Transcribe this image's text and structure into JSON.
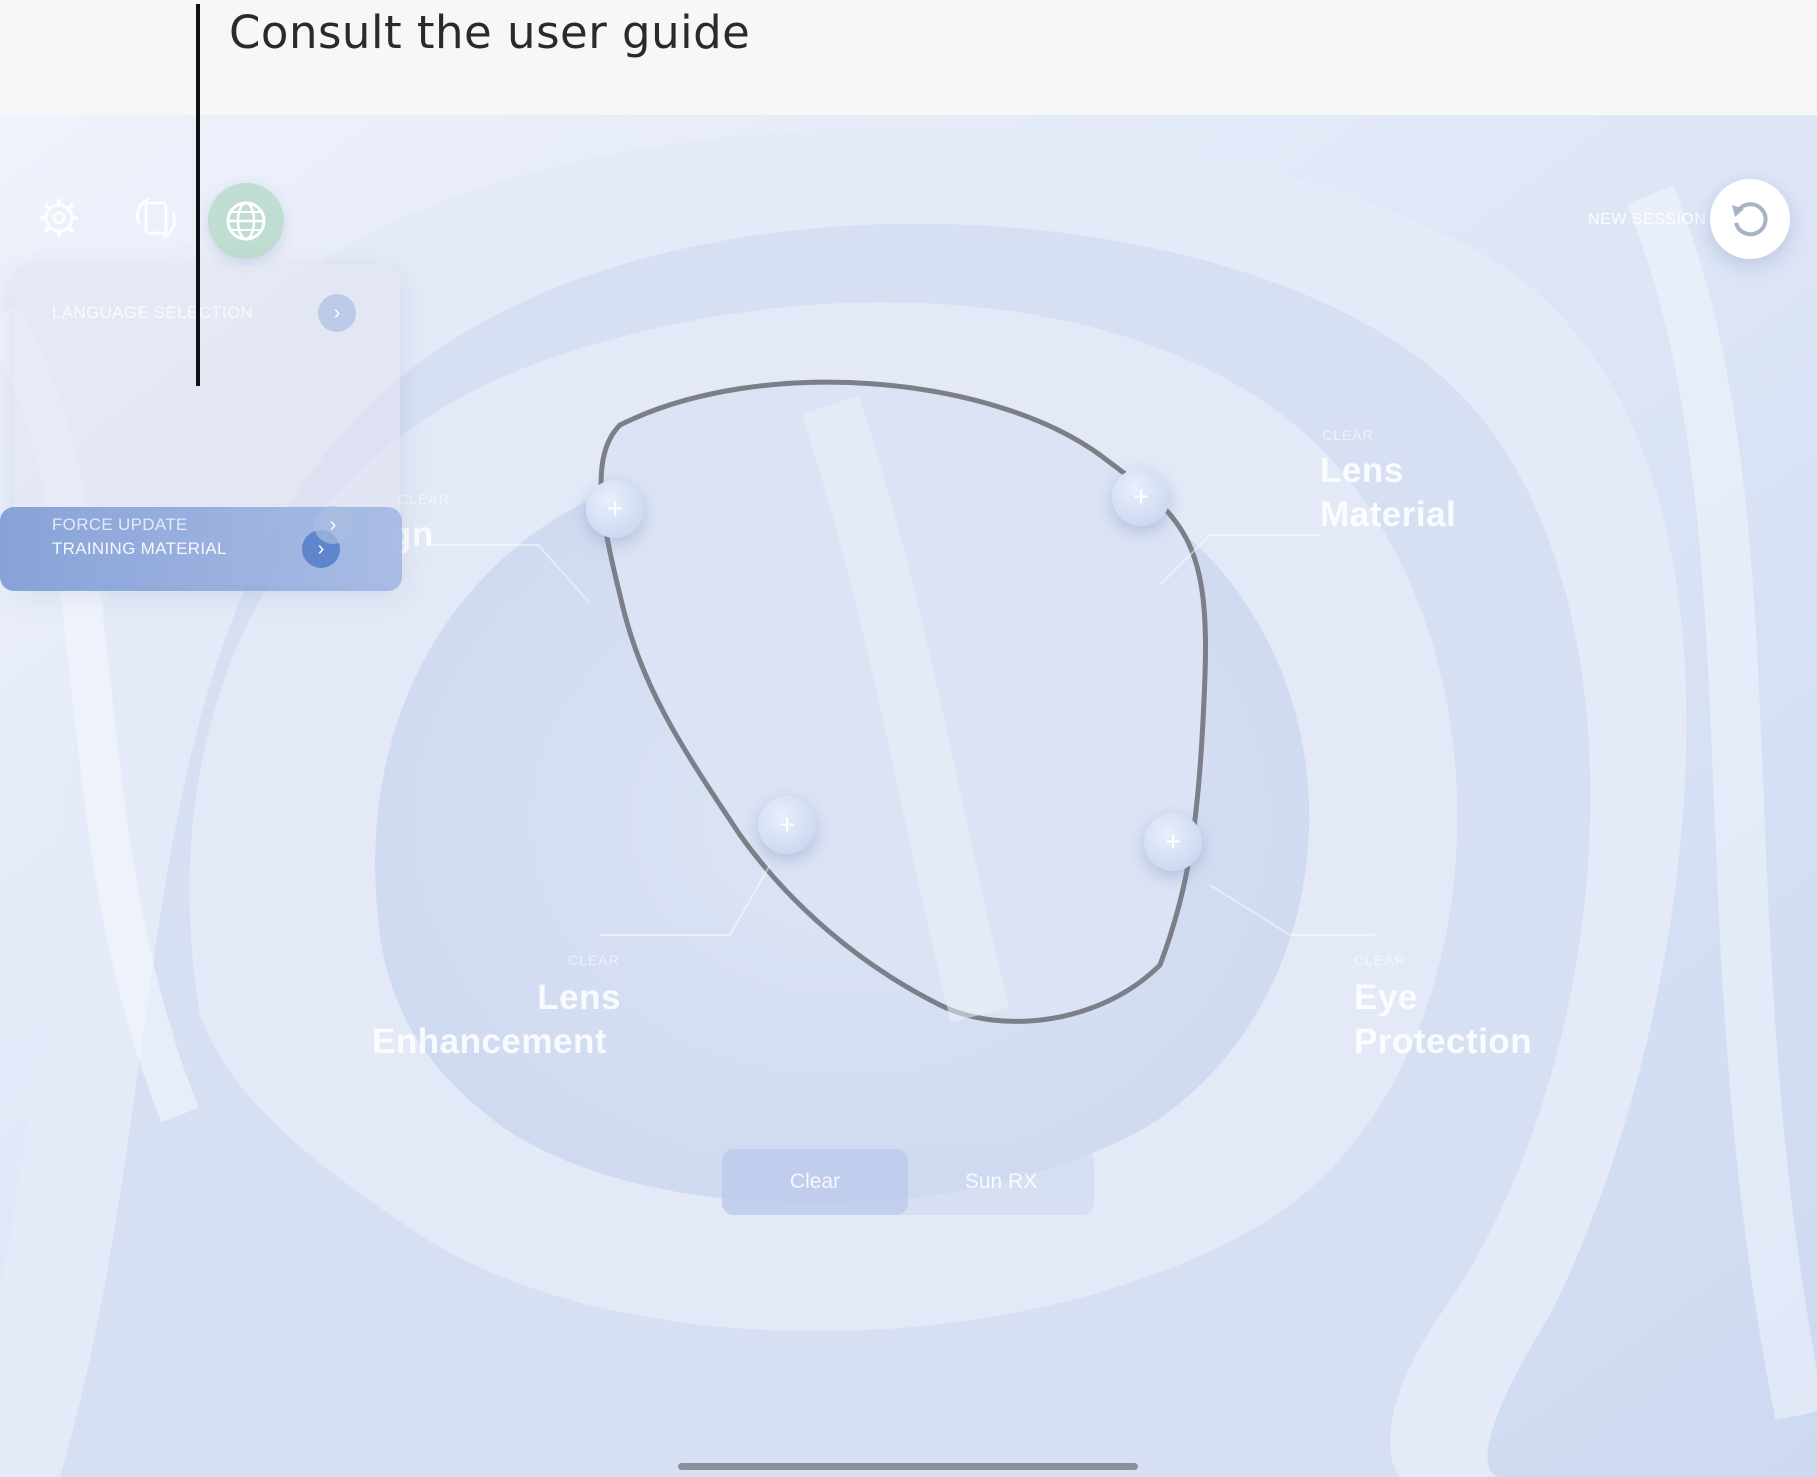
{
  "annotation": {
    "text": "Consult the user guide"
  },
  "topbar": {
    "settings_icon": "gear-icon",
    "rotate_icon": "rotate-device-icon",
    "globe_icon": "globe-icon",
    "new_session_label": "NEW SESSION",
    "new_session_icon": "refresh-icon"
  },
  "menu": {
    "items": [
      {
        "label": "LANGUAGE SELECTION",
        "active": false
      },
      {
        "label": "TRAINING MATERIAL",
        "active": true
      },
      {
        "label": "FORCE UPDATE",
        "active": false
      }
    ]
  },
  "features": {
    "design": {
      "small": "CLEAR",
      "big_line1": "gn"
    },
    "lens_material": {
      "small": "CLEAR",
      "big_line1": "Lens",
      "big_line2": "Material"
    },
    "lens_enhancement": {
      "small": "CLEAR",
      "big_line1": "Lens",
      "big_line2": "Enhancement"
    },
    "eye_protection": {
      "small": "CLEAR",
      "big_line1": "Eye",
      "big_line2": "Protection"
    }
  },
  "segmented": {
    "options": [
      "Clear",
      "Sun RX"
    ],
    "selected": "Clear"
  },
  "colors": {
    "accent": "#5f85cc",
    "background": "#dfe6f4",
    "badge_green": "#8cc8a0"
  }
}
